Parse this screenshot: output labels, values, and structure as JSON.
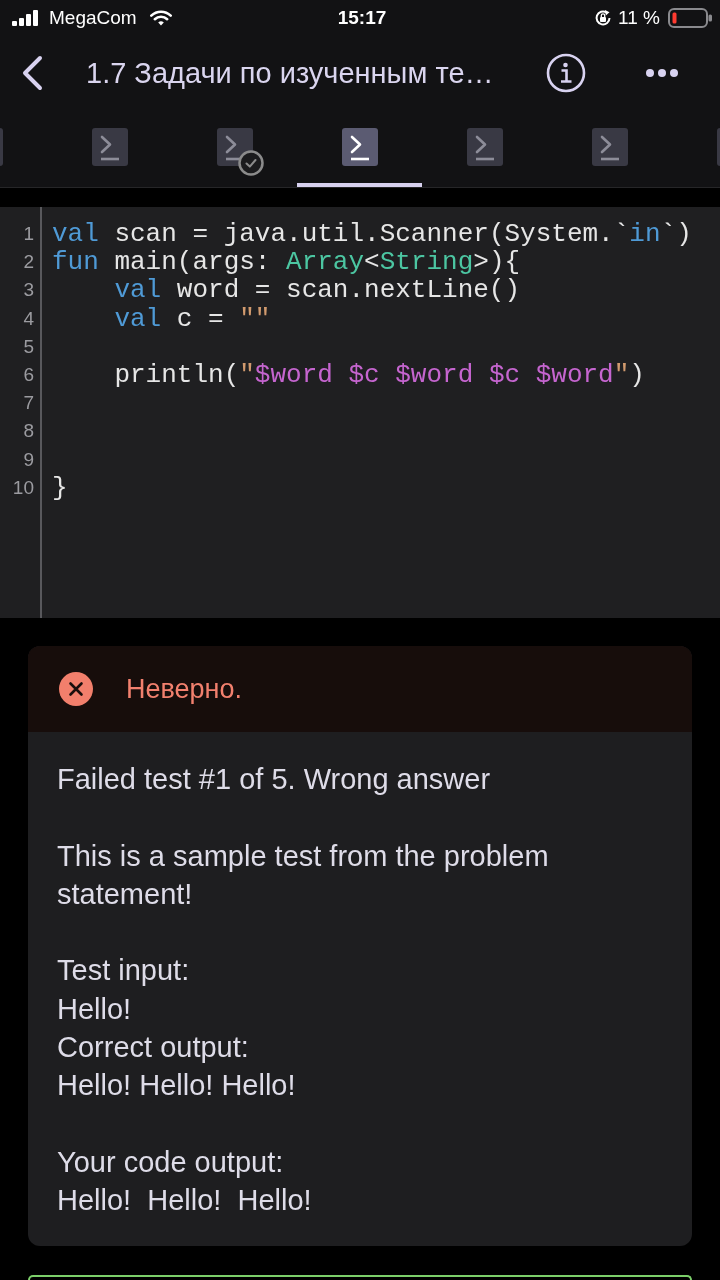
{
  "status_bar": {
    "carrier": "MegaCom",
    "time": "15:17",
    "battery": "11 %"
  },
  "nav": {
    "title": "1.7 Задачи по изученным те…"
  },
  "steps": [
    {
      "selected": false,
      "solved": false
    },
    {
      "selected": false,
      "solved": false
    },
    {
      "selected": false,
      "solved": true
    },
    {
      "selected": true,
      "solved": false
    },
    {
      "selected": false,
      "solved": false
    },
    {
      "selected": false,
      "solved": false
    },
    {
      "selected": false,
      "solved": false
    }
  ],
  "editor": {
    "lines": [
      {
        "number": "1",
        "tokens": [
          {
            "kind": "keyword",
            "text": "val"
          },
          {
            "kind": "plain",
            "text": " scan = java.util.Scanner(System.`"
          },
          {
            "kind": "keyword",
            "text": "in"
          },
          {
            "kind": "plain",
            "text": "`)"
          }
        ]
      },
      {
        "number": "2",
        "tokens": [
          {
            "kind": "keyword",
            "text": "fun"
          },
          {
            "kind": "plain",
            "text": " main(args: "
          },
          {
            "kind": "type",
            "text": "Array"
          },
          {
            "kind": "plain",
            "text": "<"
          },
          {
            "kind": "type",
            "text": "String"
          },
          {
            "kind": "plain",
            "text": ">){"
          }
        ]
      },
      {
        "number": "3",
        "tokens": [
          {
            "kind": "keyword",
            "text": "    val"
          },
          {
            "kind": "plain",
            "text": " word = scan.nextLine()"
          }
        ]
      },
      {
        "number": "4",
        "tokens": [
          {
            "kind": "keyword",
            "text": "    val"
          },
          {
            "kind": "plain",
            "text": " c = "
          },
          {
            "kind": "string",
            "text": "\"\""
          }
        ]
      },
      {
        "number": "5"
      },
      {
        "number": "6",
        "tokens": [
          {
            "kind": "plain",
            "text": "    println("
          },
          {
            "kind": "string",
            "text": "\""
          },
          {
            "kind": "template",
            "text": "$word $c $word $c $word"
          },
          {
            "kind": "string",
            "text": "\""
          },
          {
            "kind": "plain",
            "text": ")"
          }
        ]
      },
      {
        "number": "7"
      },
      {
        "number": "8"
      },
      {
        "number": "9"
      },
      {
        "number": "10",
        "tokens": [
          {
            "kind": "plain",
            "text": "}"
          }
        ]
      }
    ]
  },
  "result": {
    "kind": "wrong",
    "status": "Неверно.",
    "paragraphs": [
      {
        "lines": [
          "Failed test #1 of 5. Wrong answer"
        ]
      },
      {
        "lines": [
          "This is a sample test from the problem statement!"
        ]
      },
      {
        "lines": [
          "Test input:",
          "Hello!",
          "Correct output:",
          "Hello! Hello! Hello!"
        ]
      },
      {
        "lines": [
          "Your code output:",
          "Hello!  Hello!  Hello!"
        ]
      }
    ]
  }
}
